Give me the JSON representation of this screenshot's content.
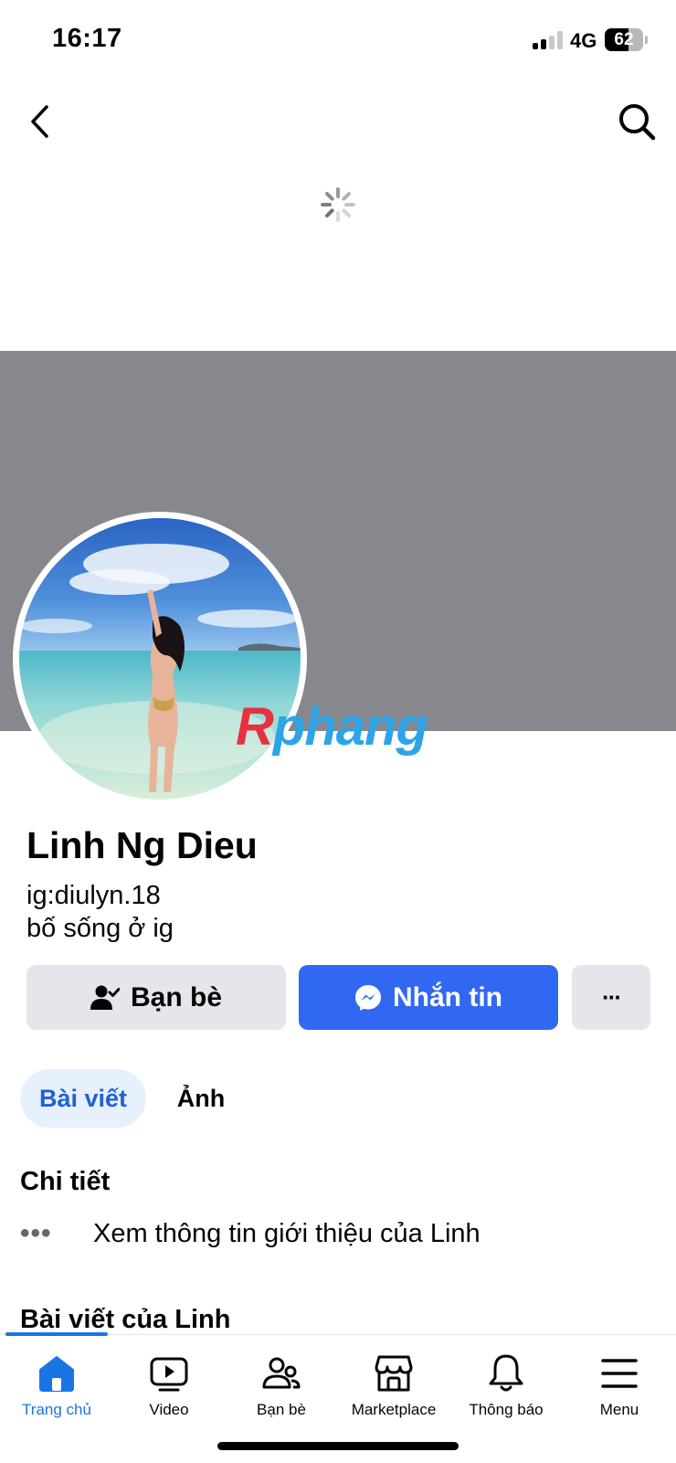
{
  "status_bar": {
    "time": "16:17",
    "network": "4G",
    "battery": "62",
    "battery_level": 0.62
  },
  "profile": {
    "name": "Linh Ng Dieu",
    "bio_lines": [
      "ig:diulyn.18",
      "bố sống ở ig"
    ]
  },
  "watermark": {
    "first": "R",
    "rest": "phang"
  },
  "actions": {
    "friends_label": "Bạn bè",
    "message_label": "Nhắn tin",
    "more_label": "···"
  },
  "tabs": [
    {
      "label": "Bài viết",
      "active": true
    },
    {
      "label": "Ảnh",
      "active": false
    }
  ],
  "details": {
    "title": "Chi tiết",
    "intro_dots": "•••",
    "intro_text": "Xem thông tin giới thiệu của Linh"
  },
  "posts_section": {
    "title": "Bài viết của Linh"
  },
  "bottom_nav": [
    {
      "label": "Trang chủ",
      "icon": "home-icon",
      "active": true
    },
    {
      "label": "Video",
      "icon": "video-icon",
      "active": false
    },
    {
      "label": "Bạn bè",
      "icon": "friends-icon",
      "active": false
    },
    {
      "label": "Marketplace",
      "icon": "marketplace-icon",
      "active": false
    },
    {
      "label": "Thông báo",
      "icon": "bell-icon",
      "active": false
    },
    {
      "label": "Menu",
      "icon": "menu-icon",
      "active": false
    }
  ],
  "colors": {
    "accent": "#1b74e4",
    "message_button": "#3168f2",
    "cover": "#87888d",
    "button_gray": "#e4e6eb"
  }
}
